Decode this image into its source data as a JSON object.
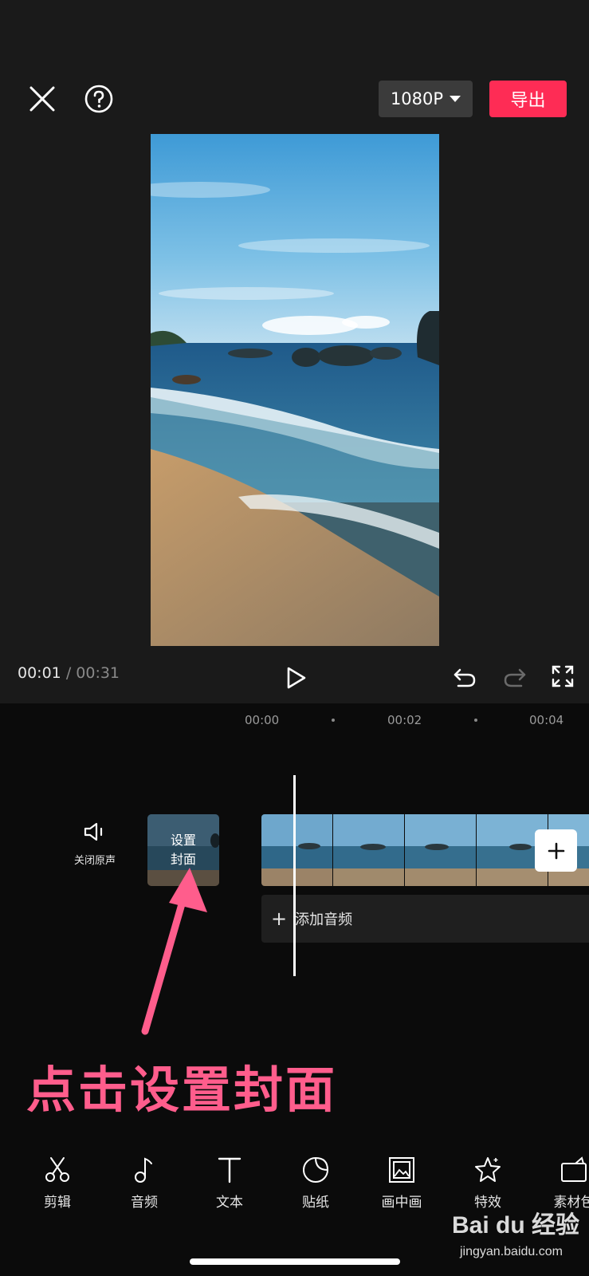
{
  "header": {
    "resolution": "1080P",
    "export_label": "导出"
  },
  "player": {
    "current_time": "00:01",
    "separator": "/",
    "total_time": "00:31"
  },
  "timeline": {
    "ruler": [
      "00:00",
      "00:02",
      "00:04"
    ],
    "mute_label": "关闭原声",
    "cover_line1": "设置",
    "cover_line2": "封面",
    "add_audio_label": "添加音频"
  },
  "annotation": "点击设置封面",
  "toolbar": {
    "items": [
      {
        "label": "剪辑",
        "icon": "scissors-icon"
      },
      {
        "label": "音频",
        "icon": "music-note-icon"
      },
      {
        "label": "文本",
        "icon": "text-icon"
      },
      {
        "label": "贴纸",
        "icon": "sticker-icon"
      },
      {
        "label": "画中画",
        "icon": "picture-in-picture-icon"
      },
      {
        "label": "特效",
        "icon": "effects-star-icon"
      },
      {
        "label": "素材包",
        "icon": "material-pack-icon"
      }
    ]
  },
  "watermark": {
    "brand": "Bai du 经验",
    "url": "jingyan.baidu.com"
  },
  "colors": {
    "accent": "#fe2c55",
    "annotation": "#ff5d8c"
  }
}
